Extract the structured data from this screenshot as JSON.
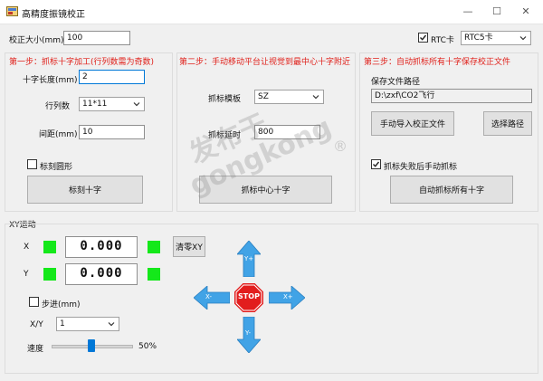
{
  "window": {
    "title": "高精度振镜校正",
    "controls": {
      "minimize": "—",
      "maximize": "☐",
      "close": "✕"
    }
  },
  "top": {
    "calib_size_label": "校正大小(mm)",
    "calib_size_value": "100",
    "rtc_card_label": "RTC卡",
    "rtc_card_checked": true,
    "rtc_select_value": "RTC5卡"
  },
  "step1": {
    "title": "第一步：抓标十字加工(行列数需为奇数)",
    "cross_len_label": "十字长度(mm)",
    "cross_len_value": "2",
    "rows_cols_label": "行列数",
    "rows_cols_value": "11*11",
    "spacing_label": "间距(mm)",
    "spacing_value": "10",
    "mark_circle_label": "标刻圆形",
    "mark_circle_checked": false,
    "mark_cross_button": "标刻十字"
  },
  "step2": {
    "title": "第二步：手动移动平台让视觉到最中心十字附近",
    "template_label": "抓标模板",
    "template_value": "SZ",
    "delay_label": "抓标延时",
    "delay_value": "800",
    "grab_center_button": "抓标中心十字"
  },
  "step3": {
    "title": "第三步：自动抓标所有十字保存校正文件",
    "save_path_label": "保存文件路径",
    "save_path_value": "D:\\zxf\\CO2飞行",
    "import_button": "手动导入校正文件",
    "choose_path_button": "选择路径",
    "manual_on_fail_label": "抓标失败后手动抓标",
    "manual_on_fail_checked": true,
    "auto_grab_button": "自动抓标所有十字"
  },
  "xy": {
    "title": "XY运动",
    "x_label": "X",
    "x_value": "0.000",
    "y_label": "Y",
    "y_value": "0.000",
    "zero_button": "清零XY",
    "step_label": "步进(mm)",
    "step_checked": false,
    "xy_label": "X/Y",
    "step_value": "1",
    "speed_label": "速度",
    "speed_percent": "50%",
    "speed_fraction": 0.5,
    "jog": {
      "up": "Y+",
      "down": "Y-",
      "left": "X-",
      "right": "X+",
      "stop": "STOP"
    }
  },
  "watermark": {
    "line1": "发布于",
    "line2": "gongkong",
    "mark": "®"
  },
  "colors": {
    "accent": "#0078d7",
    "red_title": "#e0201a",
    "led_green": "#14e81a",
    "arrow_blue": "#41a3e6",
    "stop_red": "#e21d1d"
  }
}
